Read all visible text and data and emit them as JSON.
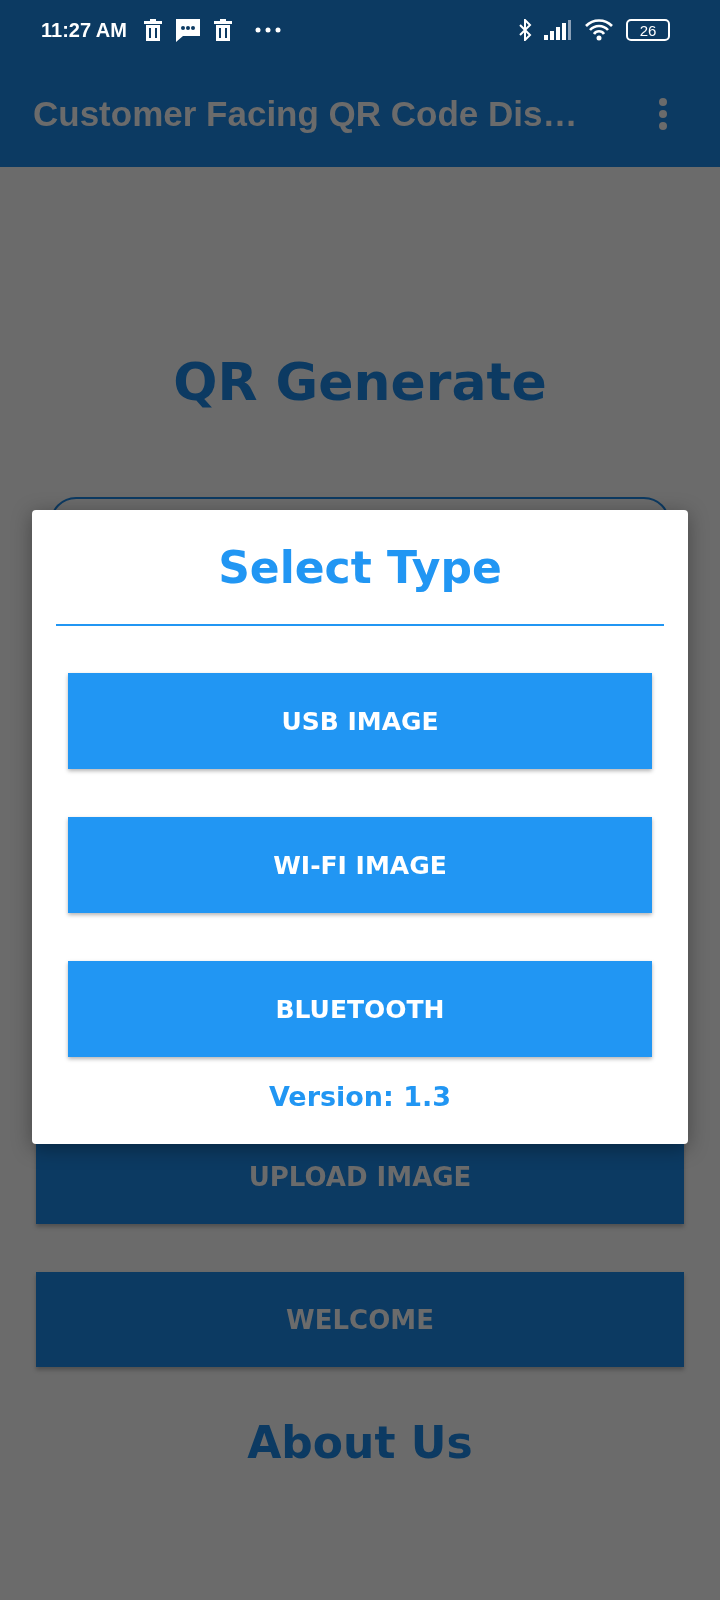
{
  "status_bar": {
    "time": "11:27 AM",
    "battery": "26"
  },
  "app_bar": {
    "title": "Customer Facing QR Code Dis…"
  },
  "page": {
    "heading": "QR Generate",
    "buttons": [
      "UPLOAD IMAGE",
      "WELCOME"
    ],
    "footer_heading": "About Us"
  },
  "dialog": {
    "title": "Select Type",
    "options": [
      "USB IMAGE",
      "WI-FI IMAGE",
      "BLUETOOTH"
    ],
    "version": "Version: 1.3"
  }
}
